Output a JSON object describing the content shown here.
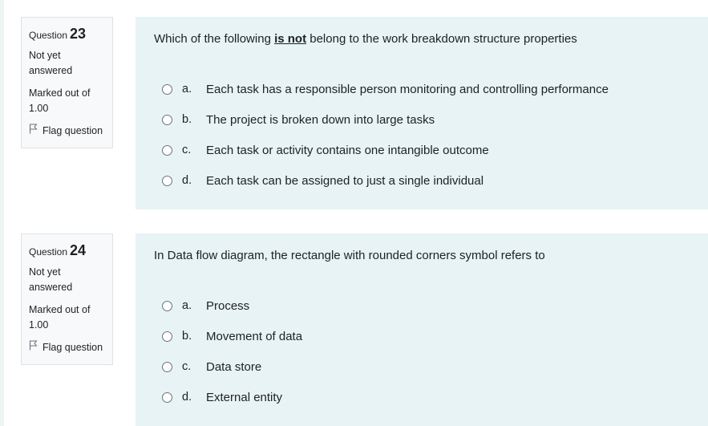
{
  "questions": [
    {
      "label": "Question",
      "number": "23",
      "state": "Not yet answered",
      "grade": "Marked out of 1.00",
      "flag_label": "Flag question",
      "text_before": "Which of the following ",
      "text_emphasis": "is not",
      "text_after": " belong to the work breakdown structure properties",
      "answers": [
        {
          "letter": "a.",
          "text": "Each task has a responsible person monitoring and controlling performance"
        },
        {
          "letter": "b.",
          "text": "The project is broken down into large tasks"
        },
        {
          "letter": "c.",
          "text": "Each task or activity contains one intangible outcome"
        },
        {
          "letter": "d.",
          "text": "Each task can be assigned to just a single individual"
        }
      ]
    },
    {
      "label": "Question",
      "number": "24",
      "state": "Not yet answered",
      "grade": "Marked out of 1.00",
      "flag_label": "Flag question",
      "text_before": "In Data flow diagram, the rectangle with rounded corners symbol refers to",
      "text_emphasis": "",
      "text_after": "",
      "answers": [
        {
          "letter": "a.",
          "text": "Process"
        },
        {
          "letter": "b.",
          "text": "Movement of data"
        },
        {
          "letter": "c.",
          "text": "Data store"
        },
        {
          "letter": "d.",
          "text": "External entity"
        }
      ]
    }
  ],
  "colors": {
    "panel_bg": "#e7f3f5",
    "info_bg": "#f8f9fa",
    "text": "#1d2125"
  },
  "icons": {
    "flag": "flag-icon",
    "radio": "radio-unchecked-icon"
  }
}
